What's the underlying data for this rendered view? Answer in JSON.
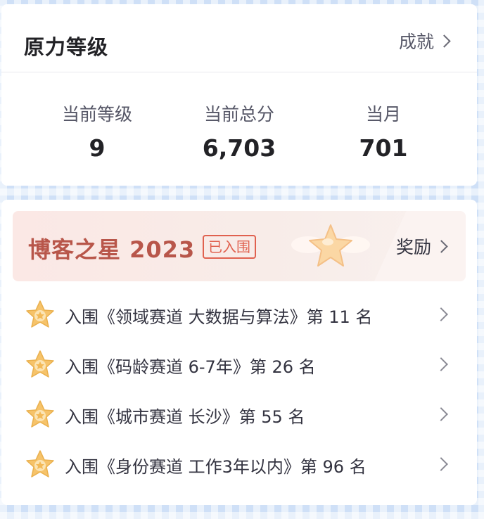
{
  "level_card": {
    "title": "原力等级",
    "achievement_label": "成就",
    "stats": [
      {
        "label": "当前等级",
        "value": "9"
      },
      {
        "label": "当前总分",
        "value": "6,703"
      },
      {
        "label": "当月",
        "value": "701"
      }
    ]
  },
  "star_card": {
    "title": "博客之星 2023",
    "badge": "已入围",
    "reward_label": "奖励",
    "items": [
      {
        "text": "入围《领域赛道 大数据与算法》第 11 名"
      },
      {
        "text": "入围《码龄赛道 6-7年》第 26 名"
      },
      {
        "text": "入围《城市赛道 长沙》第 55 名"
      },
      {
        "text": "入围《身份赛道 工作3年以内》第 96 名"
      }
    ]
  },
  "colors": {
    "accent_red": "#e0614f",
    "title_red": "#b8564a",
    "star_gold": "#f6c36a",
    "background_blue": "#cfe0f7"
  }
}
